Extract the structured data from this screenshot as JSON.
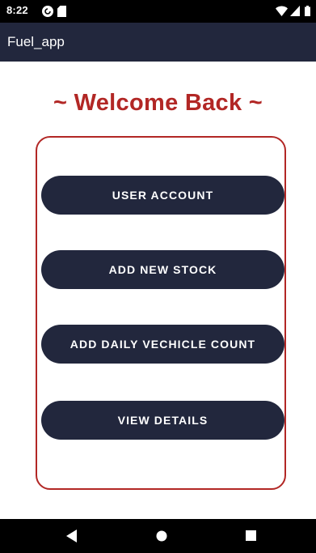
{
  "status_bar": {
    "time": "8:22",
    "icons": [
      "pocket-casts-icon",
      "sd-card-icon",
      "wifi-icon",
      "signal-icon",
      "battery-icon"
    ]
  },
  "app_bar": {
    "title": "Fuel_app"
  },
  "welcome_text": "~ Welcome Back ~",
  "menu": {
    "buttons": [
      {
        "label": "USER ACCOUNT"
      },
      {
        "label": "ADD NEW STOCK"
      },
      {
        "label": "ADD DAILY VECHICLE COUNT"
      },
      {
        "label": "VIEW DETAILS"
      }
    ]
  },
  "navigation_bar": {
    "buttons": [
      "back-icon",
      "home-icon",
      "recents-icon"
    ]
  },
  "colors": {
    "app_bar_background": "#22273d",
    "button_background": "#22273d",
    "accent_red": "#b22725",
    "status_bar_background": "#000000",
    "page_background": "#ffffff"
  }
}
